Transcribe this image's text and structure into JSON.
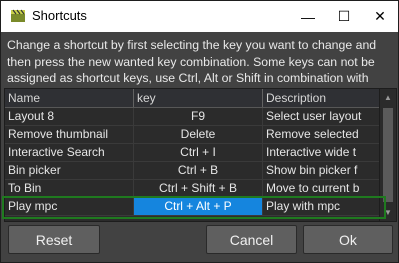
{
  "window": {
    "title": "Shortcuts",
    "icon": "clapperboard-icon",
    "minimize": "—",
    "maximize": "☐",
    "close": "✕"
  },
  "instructions": "Change a shortcut by first selecting the key you want to change and then press the new wanted key combination. Some keys can not be assigned as shortcut keys, use Ctrl, Alt or Shift in combination with keys.",
  "table": {
    "headers": [
      "Name",
      "key",
      "Description"
    ],
    "rows": [
      {
        "name": "Layout 8",
        "key": "F9",
        "description": "Select user layout"
      },
      {
        "name": "Remove thumbnail",
        "key": "Delete",
        "description": "Remove selected"
      },
      {
        "name": "Interactive Search",
        "key": "Ctrl + I",
        "description": "Interactive wide t"
      },
      {
        "name": "Bin picker",
        "key": "Ctrl + B",
        "description": "Show bin picker f"
      },
      {
        "name": "To Bin",
        "key": "Ctrl + Shift + B",
        "description": "Move to current b"
      },
      {
        "name": "Play mpc",
        "key": "Ctrl + Alt + P",
        "description": "Play with mpc"
      }
    ],
    "selected_row": 5
  },
  "buttons": {
    "reset": "Reset",
    "cancel": "Cancel",
    "ok": "Ok"
  },
  "colors": {
    "selection_key_bg": "#1585de",
    "highlight_border": "#1f7a1f",
    "window_bg": "#424242"
  }
}
